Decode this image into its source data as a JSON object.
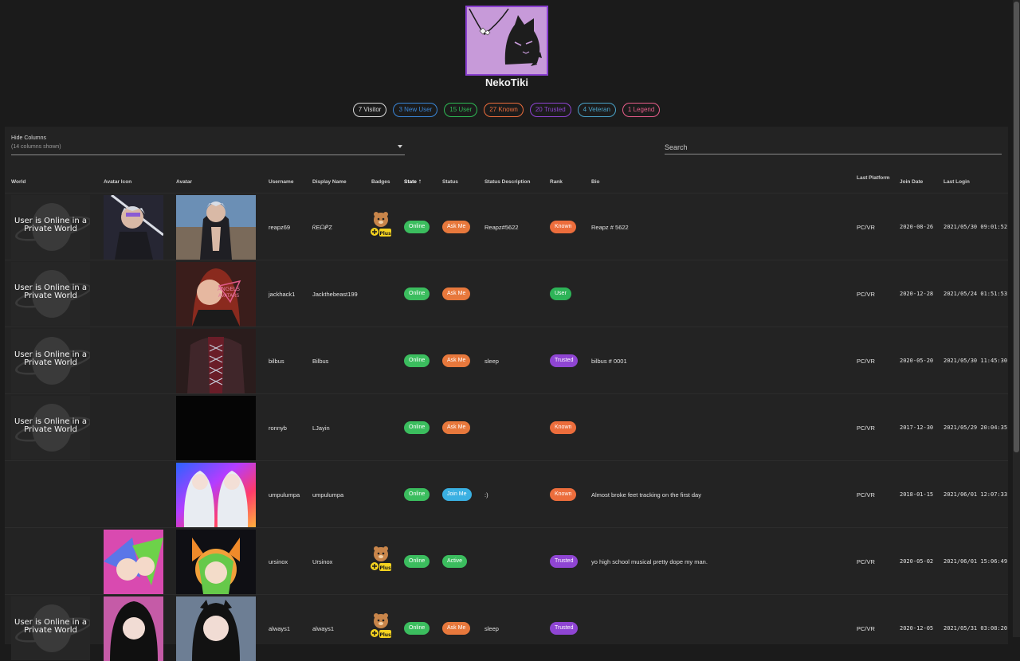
{
  "profile": {
    "name": "NekoTiki",
    "avatar_bg": "#c79ad9",
    "avatar_border": "#8a3fd0"
  },
  "chips": [
    {
      "label": "7 Visitor",
      "color": "#d9d9d9"
    },
    {
      "label": "3 New User",
      "color": "#3a86d8"
    },
    {
      "label": "15 User",
      "color": "#2eba55"
    },
    {
      "label": "27 Known",
      "color": "#ec6d3c"
    },
    {
      "label": "20 Trusted",
      "color": "#8f45d3"
    },
    {
      "label": "4 Veteran",
      "color": "#4aa3c9"
    },
    {
      "label": "1 Legend",
      "color": "#e85d8a"
    }
  ],
  "controls": {
    "hide_columns_label": "Hide Columns",
    "hide_columns_value": "(14 columns shown)",
    "search_placeholder": "Search"
  },
  "columns": {
    "world": "World",
    "avatar_icon": "Avatar Icon",
    "avatar": "Avatar",
    "username": "Username",
    "display_name": "Display Name",
    "badges": "Badges",
    "state": "State",
    "status": "Status",
    "status_description": "Status Description",
    "rank": "Rank",
    "bio": "Bio",
    "last_platform": "Last Platform",
    "join_date": "Join Date",
    "last_login": "Last Login"
  },
  "world_private_text": "User is Online in a Private World",
  "rows": [
    {
      "world": "private",
      "avatar_icon": true,
      "avatar_style": "a1",
      "username": "reapz69",
      "display_name": "ᖇEᗩᑭZ",
      "badge": true,
      "state": "Online",
      "status": "Ask Me",
      "status_kind": "askme",
      "status_description": "Reapz#5622",
      "rank": "Known",
      "rank_kind": "known",
      "bio": "Reapz # 5622",
      "last_platform": "PC/VR",
      "join_date": "2020-08-26",
      "last_login": "2021/05/30 09:01:52"
    },
    {
      "world": "private",
      "avatar_icon": false,
      "avatar_style": "a2",
      "username": "jackhack1",
      "display_name": "Jackthebeast199",
      "badge": false,
      "state": "Online",
      "status": "Ask Me",
      "status_kind": "askme",
      "status_description": "",
      "rank": "User",
      "rank_kind": "user",
      "bio": "",
      "last_platform": "PC/VR",
      "join_date": "2020-12-28",
      "last_login": "2021/05/24 01:51:53"
    },
    {
      "world": "private",
      "avatar_icon": false,
      "avatar_style": "a3",
      "username": "bilbus",
      "display_name": "Bilbus",
      "badge": false,
      "state": "Online",
      "status": "Ask Me",
      "status_kind": "askme",
      "status_description": "sleep",
      "rank": "Trusted",
      "rank_kind": "trusted",
      "bio": "bilbus # 0001",
      "last_platform": "PC/VR",
      "join_date": "2020-05-20",
      "last_login": "2021/05/30 11:45:30"
    },
    {
      "world": "private",
      "avatar_icon": false,
      "avatar_style": "a4",
      "username": "ronnyb",
      "display_name": "LJayin",
      "badge": false,
      "state": "Online",
      "status": "Ask Me",
      "status_kind": "askme",
      "status_description": "",
      "rank": "Known",
      "rank_kind": "known",
      "bio": "",
      "last_platform": "PC/VR",
      "join_date": "2017-12-30",
      "last_login": "2021/05/29 20:04:35"
    },
    {
      "world": "none",
      "avatar_icon": false,
      "avatar_style": "a5",
      "username": "umpulumpa",
      "display_name": "umpulumpa",
      "badge": false,
      "state": "Online",
      "status": "Join Me",
      "status_kind": "joinme",
      "status_description": ":)",
      "rank": "Known",
      "rank_kind": "known",
      "bio": "Almost broke feet tracking on the first day",
      "last_platform": "PC/VR",
      "join_date": "2018-01-15",
      "last_login": "2021/06/01 12:07:33"
    },
    {
      "world": "none",
      "avatar_icon": true,
      "avatar_style": "a6",
      "username": "ursinox",
      "display_name": "Ursinox",
      "badge": true,
      "state": "Online",
      "status": "Active",
      "status_kind": "active",
      "status_description": "",
      "rank": "Trusted",
      "rank_kind": "trusted",
      "bio": "yo high school musical pretty dope my man.",
      "last_platform": "PC/VR",
      "join_date": "2020-05-02",
      "last_login": "2021/06/01 15:06:49"
    },
    {
      "world": "private",
      "avatar_icon": true,
      "avatar_style": "a7",
      "username": "always1",
      "display_name": "always1",
      "badge": true,
      "state": "Online",
      "status": "Ask Me",
      "status_kind": "askme",
      "status_description": "sleep",
      "rank": "Trusted",
      "rank_kind": "trusted",
      "bio": "",
      "last_platform": "PC/VR",
      "join_date": "2020-12-05",
      "last_login": "2021/05/31 03:08:20"
    }
  ]
}
